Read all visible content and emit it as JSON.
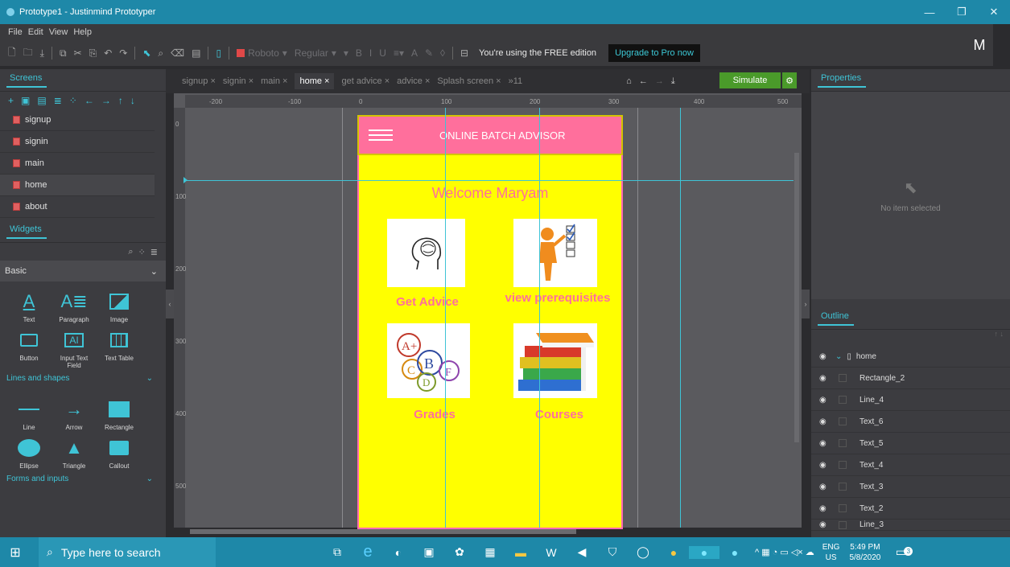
{
  "window": {
    "title": "Prototype1 - Justinmind Prototyper",
    "controls": [
      "—",
      "❐",
      "✕"
    ]
  },
  "menu": [
    "File",
    "Edit",
    "View",
    "Help"
  ],
  "toolbar": {
    "font_name": "Roboto",
    "font_style": "Regular",
    "bold": "B",
    "italic": "I",
    "underline": "U",
    "font_color": "A",
    "edition_notice": "You're using the FREE edition",
    "upgrade_label": "Upgrade to Pro now"
  },
  "user": {
    "initial": "M"
  },
  "screens_panel": {
    "title": "Screens",
    "items": [
      "signup",
      "signin",
      "main",
      "home",
      "about"
    ],
    "active": "home"
  },
  "widgets_panel": {
    "title": "Widgets",
    "category": "Basic",
    "basic": [
      {
        "label": "Text",
        "icon": "text-icon"
      },
      {
        "label": "Paragraph",
        "icon": "paragraph-icon"
      },
      {
        "label": "Image",
        "icon": "image-icon"
      },
      {
        "label": "Button",
        "icon": "button-icon"
      },
      {
        "label": "Input Text Field",
        "icon": "input-field-icon"
      },
      {
        "label": "Text Table",
        "icon": "table-icon"
      }
    ],
    "group_lines": "Lines and shapes",
    "shapes": [
      {
        "label": "Line",
        "icon": "line-icon"
      },
      {
        "label": "Arrow",
        "icon": "arrow-icon"
      },
      {
        "label": "Rectangle",
        "icon": "rectangle-icon"
      },
      {
        "label": "Ellipse",
        "icon": "ellipse-icon"
      },
      {
        "label": "Triangle",
        "icon": "triangle-icon"
      },
      {
        "label": "Callout",
        "icon": "callout-icon"
      }
    ],
    "group_forms": "Forms and inputs"
  },
  "tabs": {
    "items": [
      "signup",
      "signin",
      "main",
      "home",
      "get advice",
      "advice",
      "Splash screen"
    ],
    "active": "home",
    "overflow": "»11",
    "simulate_label": "Simulate"
  },
  "ruler": {
    "h_ticks": [
      "-200",
      "-100",
      "0",
      "100",
      "200",
      "300",
      "400",
      "500"
    ],
    "v_ticks": [
      "0",
      "100",
      "200",
      "300",
      "400",
      "500"
    ]
  },
  "app": {
    "header_title": "ONLINE BATCH ADVISOR",
    "welcome": "Welcome Maryam",
    "cards": [
      {
        "label": "Get Advice",
        "icon": "brain-head-icon"
      },
      {
        "label": "view prerequisites",
        "icon": "checklist-figure-icon"
      },
      {
        "label": "Grades",
        "icon": "grades-letters-icon"
      },
      {
        "label": "Courses",
        "icon": "books-stack-icon"
      }
    ]
  },
  "properties_panel": {
    "title": "Properties",
    "empty_text": "No item selected"
  },
  "outline_panel": {
    "title": "Outline",
    "root": "home",
    "items": [
      "Rectangle_2",
      "Line_4",
      "Text_6",
      "Text_5",
      "Text_4",
      "Text_3",
      "Text_2",
      "Line_3"
    ]
  },
  "taskbar": {
    "search_placeholder": "Type here to search",
    "lang": "ENG",
    "region": "US",
    "time": "5:49 PM",
    "date": "5/8/2020",
    "notification_count": "3"
  },
  "colors": {
    "accent": "#3fc4d6",
    "app_header": "#ff6f9c",
    "app_bg": "#ffff00",
    "titlebar": "#1e88a8",
    "simulate": "#4a9a2a"
  }
}
